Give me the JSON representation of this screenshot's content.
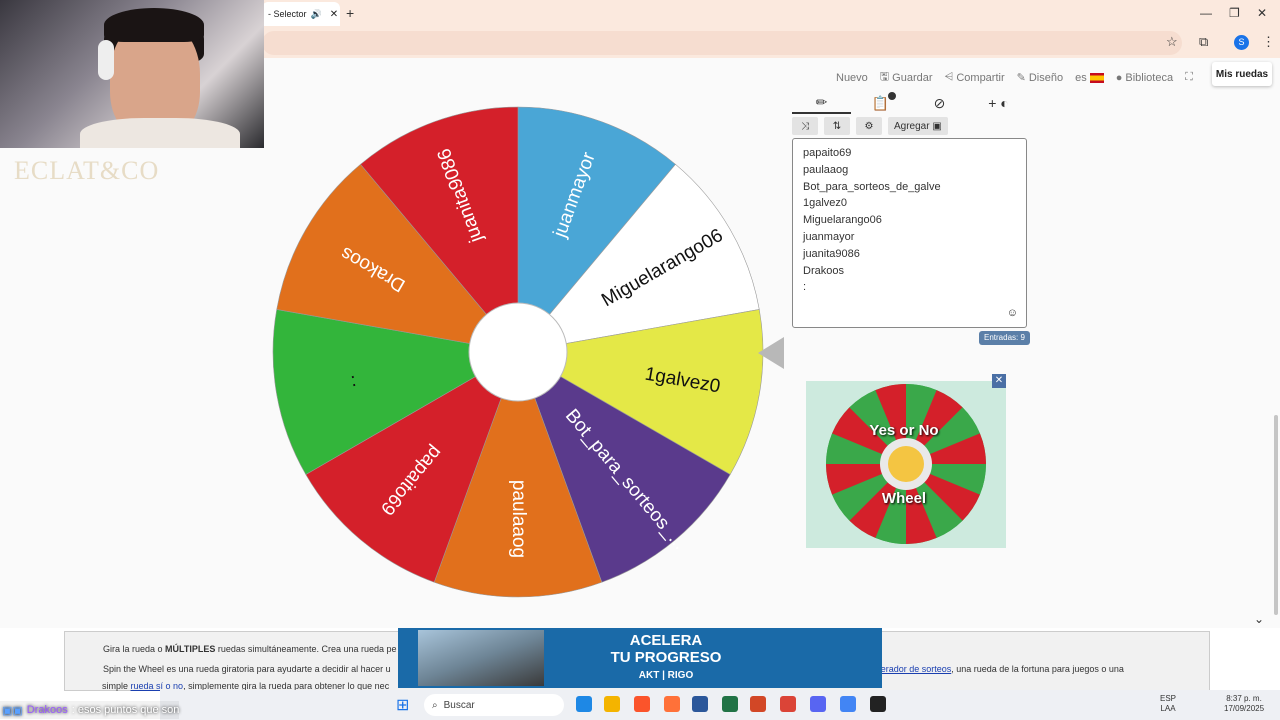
{
  "browser": {
    "tab_title": "- Selector",
    "tab_close": "✕",
    "new_tab": "+",
    "window_controls": [
      "—",
      "❐",
      "✕"
    ],
    "profile_initial": "S"
  },
  "nav": {
    "nuevo": "Nuevo",
    "guardar": "Guardar",
    "compartir": "Compartir",
    "diseno": "Diseño",
    "lang": "es",
    "biblioteca": "Biblioteca",
    "mis_ruedas": "Mis ruedas"
  },
  "webcam": {
    "brand": "ECLAT&CO"
  },
  "wheel": {
    "segments": [
      {
        "label": "juanmayor",
        "color": "#4aa6d6"
      },
      {
        "label": "Miguelarango06",
        "color": "#ffffff"
      },
      {
        "label": "1galvez0",
        "color": "#e4e847"
      },
      {
        "label": "Bot_para_sorteos_...",
        "color": "#5a3a8c"
      },
      {
        "label": "paulaaog",
        "color": "#e1701c"
      },
      {
        "label": "papaito69",
        "color": "#d4202a"
      },
      {
        "label": ":",
        "color": "#33b53b"
      },
      {
        "label": "Drakoos",
        "color": "#e1701c"
      },
      {
        "label": "juanita9086",
        "color": "#d4202a"
      }
    ]
  },
  "panel": {
    "tab_icons": [
      "pencil-icon",
      "clipboard-icon",
      "eye-slash-icon",
      "plus-icon"
    ],
    "tools": {
      "shuffle": "⤨",
      "sort": "⇅",
      "settings": "⚙",
      "agregar": "Agregar"
    },
    "entries": [
      "papaito69",
      "paulaaog",
      "Bot_para_sorteos_de_galve",
      "1galvez0",
      "Miguelarango06",
      "juanmayor",
      "juanita9086",
      "Drakoos",
      ":"
    ],
    "count_label": "Entradas: 9"
  },
  "ad": {
    "line1": "Yes or No",
    "line2": "Wheel",
    "close": "✕"
  },
  "bottom": {
    "p1_pre": "Gira la rueda o ",
    "p1_bold": "MÚLTIPLES",
    "p1_post": " ruedas simultáneamente. Crea una rueda pe",
    "p2_pre": "Spin the Wheel es una rueda giratoria para ayudarte a decidir al hacer u",
    "p2_link": "generador de sorteos",
    "p2_post": ", una rueda de la fortuna para juegos o una",
    "p3_pre": "simple ",
    "p3_link": "rueda sí o no",
    "p3_post": ", simplemente gira la rueda para obtener lo que nec"
  },
  "banner": {
    "title1": "ACELERA",
    "title2": "TU PROGRESO",
    "sub": "AKT | RIGO"
  },
  "chat": {
    "user": "Drakoos",
    "message": ": esos puntos que son"
  },
  "taskbar": {
    "search_label": "Buscar",
    "lang1": "ESP",
    "lang2": "LAA",
    "time": "8:37 p. m.",
    "date": "17/09/2025"
  }
}
